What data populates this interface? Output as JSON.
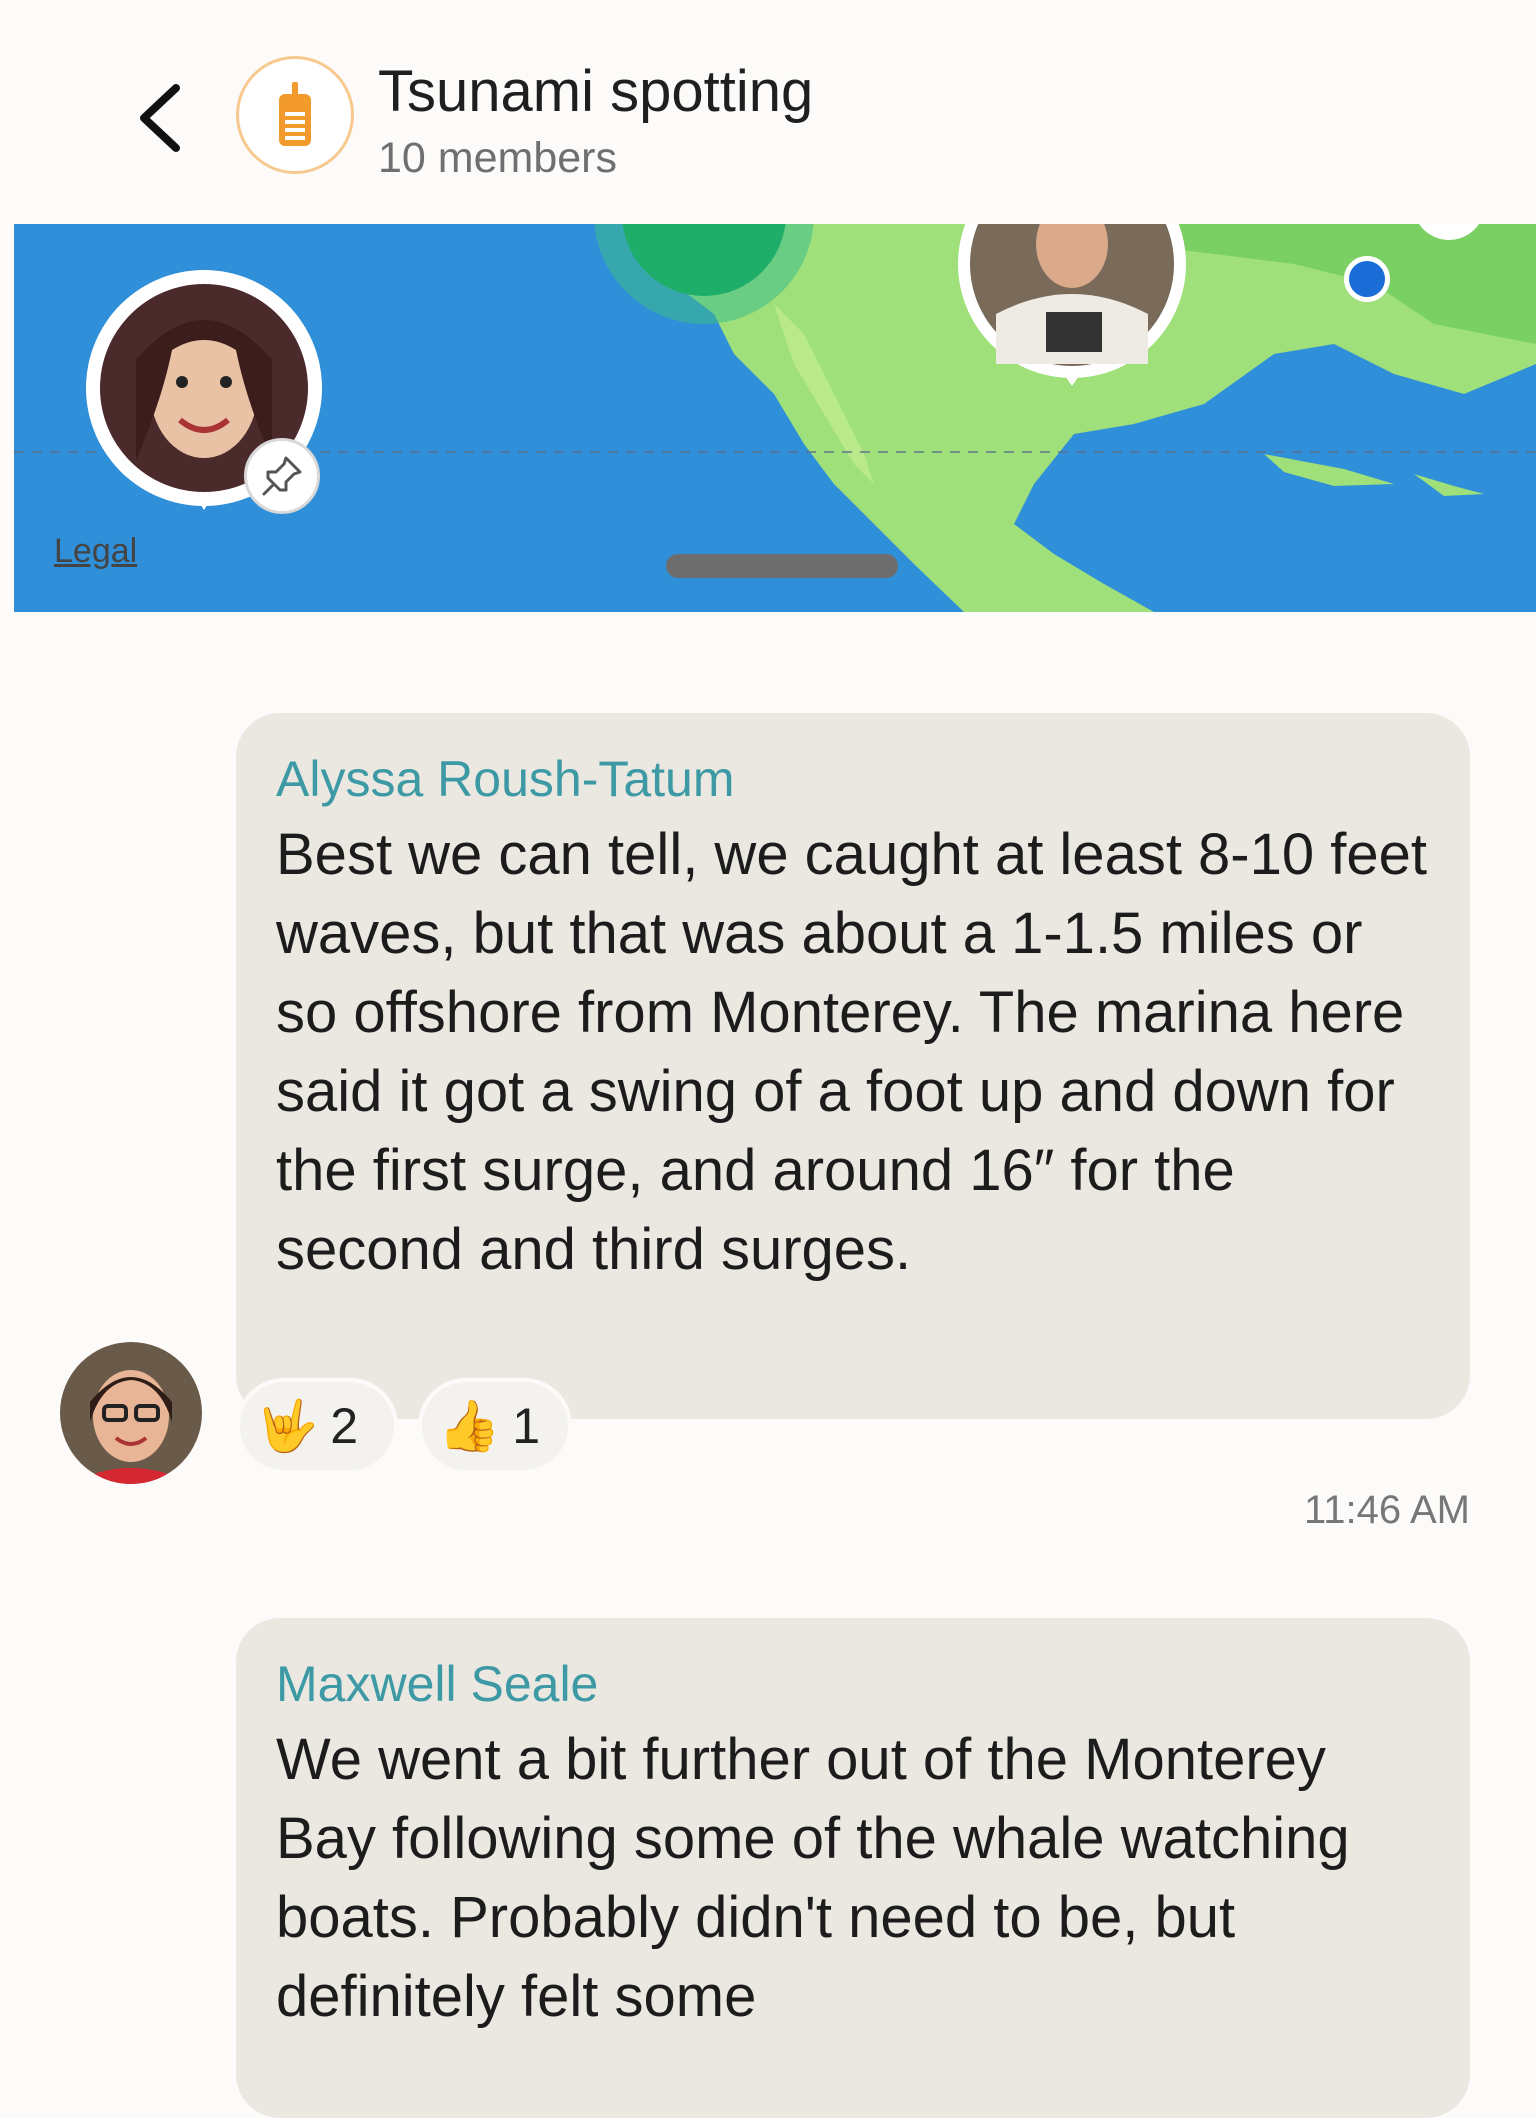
{
  "header": {
    "title": "Tsunami spotting",
    "subtitle": "10 members",
    "back_icon": "chevron-left-icon",
    "group_icon": "walkie-talkie-icon",
    "accent": "#f39a2c"
  },
  "map": {
    "legal_label": "Legal",
    "pin_icon": "pin-icon",
    "water_color": "#2f8fd8",
    "land_color": "#9fe07a"
  },
  "messages": [
    {
      "sender": "Alyssa Roush-Tatum",
      "text": "Best we can tell, we caught at least 8-10 feet waves, but that was about a 1-1.5 miles or so offshore from Monterey. The marina here said it got a swing of a foot up and down for the first surge, and around 16″ for the second and third surges.",
      "reactions": [
        {
          "emoji": "🤟",
          "icon": "love-you-hand-icon",
          "count": "2"
        },
        {
          "emoji": "👍",
          "icon": "thumbs-up-icon",
          "count": "1"
        }
      ],
      "timestamp": "11:46 AM"
    },
    {
      "sender": "Maxwell Seale",
      "text": "We went a bit further out of the Monterey Bay following some of the whale watching boats. Probably didn't need to be, but definitely felt some"
    }
  ],
  "colors": {
    "sender_name": "#3d9aa5",
    "bubble": "#ebe8e2",
    "background": "#fcfbf9"
  }
}
